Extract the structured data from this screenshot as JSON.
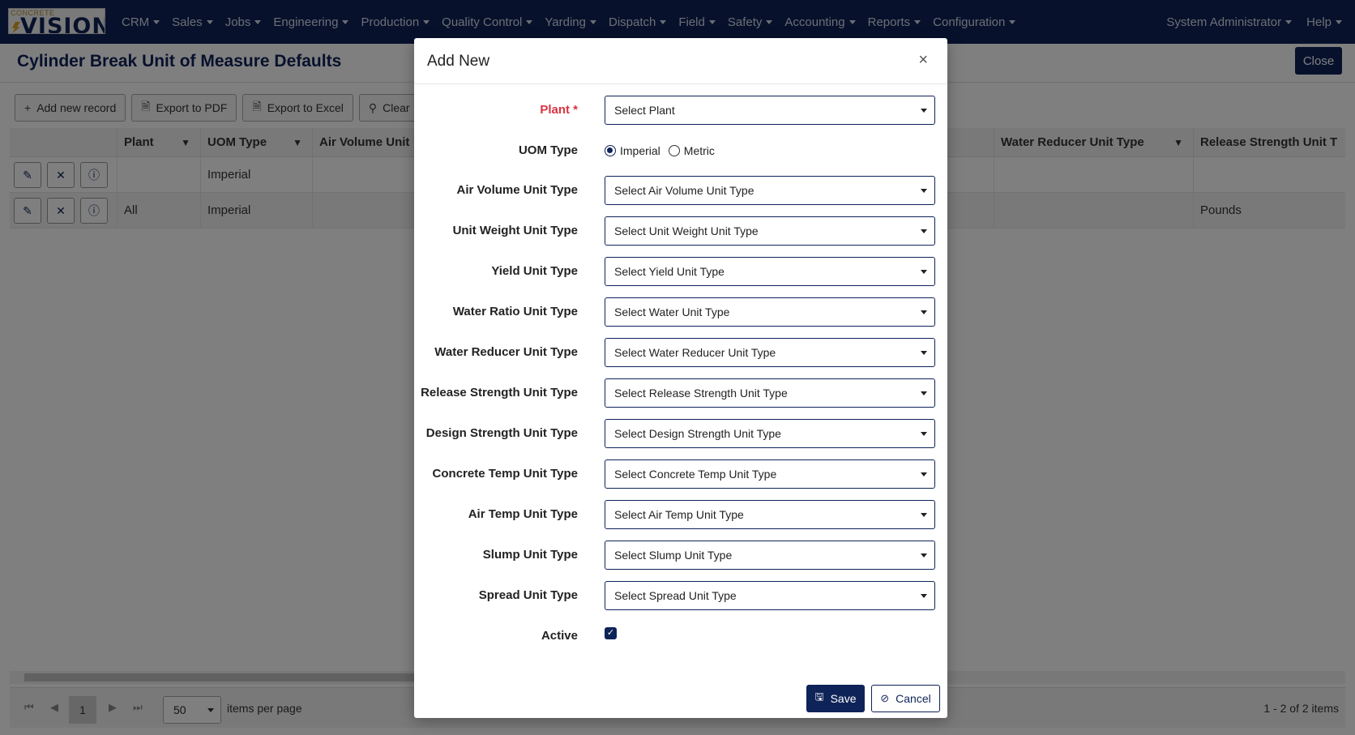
{
  "app": {
    "logo_small": "CONCRETE",
    "logo_big": "VISION"
  },
  "nav": {
    "items": [
      "CRM",
      "Sales",
      "Jobs",
      "Engineering",
      "Production",
      "Quality Control",
      "Yarding",
      "Dispatch",
      "Field",
      "Safety",
      "Accounting",
      "Reports",
      "Configuration"
    ],
    "user": "System Administrator",
    "help": "Help"
  },
  "page": {
    "title": "Cylinder Break Unit of Measure Defaults",
    "close": "Close"
  },
  "toolbar": {
    "add": "Add new record",
    "pdf": "Export to PDF",
    "excel": "Export to Excel",
    "clear": "Clear"
  },
  "grid": {
    "columns": [
      "Plant",
      "UOM Type",
      "Air Volume Unit",
      "Water Reducer Unit Type",
      "Release Strength Unit T"
    ],
    "rows": [
      {
        "plant": "",
        "uom": "Imperial",
        "release": ""
      },
      {
        "plant": "All",
        "uom": "Imperial",
        "release": "Pounds"
      }
    ]
  },
  "pager": {
    "current": "1",
    "size": "50",
    "label": "items per page",
    "info": "1 - 2 of 2 items"
  },
  "modal": {
    "title": "Add New",
    "close": "×",
    "plant_label": "Plant *",
    "plant_placeholder": "Select Plant",
    "uom_label": "UOM Type",
    "uom_options": [
      "Imperial",
      "Metric"
    ],
    "uom_selected": "Imperial",
    "fields": [
      {
        "label": "Air Volume Unit Type",
        "placeholder": "Select Air Volume Unit Type"
      },
      {
        "label": "Unit Weight Unit Type",
        "placeholder": "Select Unit Weight Unit Type"
      },
      {
        "label": "Yield Unit Type",
        "placeholder": "Select Yield Unit Type"
      },
      {
        "label": "Water Ratio Unit Type",
        "placeholder": "Select Water Unit Type"
      },
      {
        "label": "Water Reducer Unit Type",
        "placeholder": "Select Water Reducer Unit Type"
      },
      {
        "label": "Release Strength Unit Type",
        "placeholder": "Select Release Strength Unit Type"
      },
      {
        "label": "Design Strength Unit Type",
        "placeholder": "Select Design Strength Unit Type"
      },
      {
        "label": "Concrete Temp Unit Type",
        "placeholder": "Select Concrete Temp Unit Type"
      },
      {
        "label": "Air Temp Unit Type",
        "placeholder": "Select Air Temp Unit Type"
      },
      {
        "label": "Slump Unit Type",
        "placeholder": "Select Slump Unit Type"
      },
      {
        "label": "Spread Unit Type",
        "placeholder": "Select Spread Unit Type"
      }
    ],
    "active_label": "Active",
    "active_checked": true,
    "save": "Save",
    "cancel": "Cancel"
  },
  "colors": {
    "brand": "#0e2358",
    "required": "#d9333f"
  }
}
